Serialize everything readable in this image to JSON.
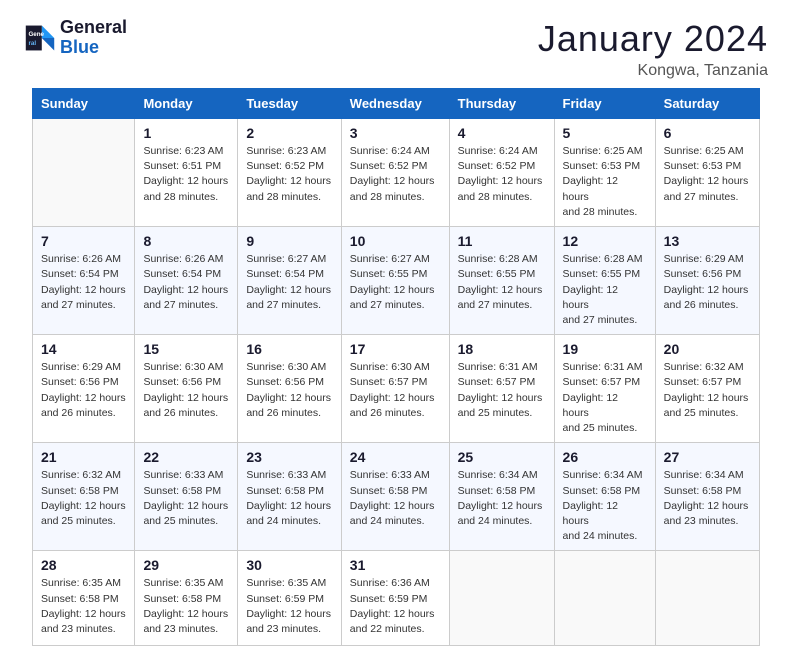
{
  "logo": {
    "general": "General",
    "blue": "Blue"
  },
  "title": "January 2024",
  "location": "Kongwa, Tanzania",
  "weekdays": [
    "Sunday",
    "Monday",
    "Tuesday",
    "Wednesday",
    "Thursday",
    "Friday",
    "Saturday"
  ],
  "weeks": [
    [
      {
        "day": "",
        "info": ""
      },
      {
        "day": "1",
        "info": "Sunrise: 6:23 AM\nSunset: 6:51 PM\nDaylight: 12 hours\nand 28 minutes."
      },
      {
        "day": "2",
        "info": "Sunrise: 6:23 AM\nSunset: 6:52 PM\nDaylight: 12 hours\nand 28 minutes."
      },
      {
        "day": "3",
        "info": "Sunrise: 6:24 AM\nSunset: 6:52 PM\nDaylight: 12 hours\nand 28 minutes."
      },
      {
        "day": "4",
        "info": "Sunrise: 6:24 AM\nSunset: 6:52 PM\nDaylight: 12 hours\nand 28 minutes."
      },
      {
        "day": "5",
        "info": "Sunrise: 6:25 AM\nSunset: 6:53 PM\nDaylight: 12 hours\nand 28 minutes."
      },
      {
        "day": "6",
        "info": "Sunrise: 6:25 AM\nSunset: 6:53 PM\nDaylight: 12 hours\nand 27 minutes."
      }
    ],
    [
      {
        "day": "7",
        "info": "Sunrise: 6:26 AM\nSunset: 6:54 PM\nDaylight: 12 hours\nand 27 minutes."
      },
      {
        "day": "8",
        "info": "Sunrise: 6:26 AM\nSunset: 6:54 PM\nDaylight: 12 hours\nand 27 minutes."
      },
      {
        "day": "9",
        "info": "Sunrise: 6:27 AM\nSunset: 6:54 PM\nDaylight: 12 hours\nand 27 minutes."
      },
      {
        "day": "10",
        "info": "Sunrise: 6:27 AM\nSunset: 6:55 PM\nDaylight: 12 hours\nand 27 minutes."
      },
      {
        "day": "11",
        "info": "Sunrise: 6:28 AM\nSunset: 6:55 PM\nDaylight: 12 hours\nand 27 minutes."
      },
      {
        "day": "12",
        "info": "Sunrise: 6:28 AM\nSunset: 6:55 PM\nDaylight: 12 hours\nand 27 minutes."
      },
      {
        "day": "13",
        "info": "Sunrise: 6:29 AM\nSunset: 6:56 PM\nDaylight: 12 hours\nand 26 minutes."
      }
    ],
    [
      {
        "day": "14",
        "info": "Sunrise: 6:29 AM\nSunset: 6:56 PM\nDaylight: 12 hours\nand 26 minutes."
      },
      {
        "day": "15",
        "info": "Sunrise: 6:30 AM\nSunset: 6:56 PM\nDaylight: 12 hours\nand 26 minutes."
      },
      {
        "day": "16",
        "info": "Sunrise: 6:30 AM\nSunset: 6:56 PM\nDaylight: 12 hours\nand 26 minutes."
      },
      {
        "day": "17",
        "info": "Sunrise: 6:30 AM\nSunset: 6:57 PM\nDaylight: 12 hours\nand 26 minutes."
      },
      {
        "day": "18",
        "info": "Sunrise: 6:31 AM\nSunset: 6:57 PM\nDaylight: 12 hours\nand 25 minutes."
      },
      {
        "day": "19",
        "info": "Sunrise: 6:31 AM\nSunset: 6:57 PM\nDaylight: 12 hours\nand 25 minutes."
      },
      {
        "day": "20",
        "info": "Sunrise: 6:32 AM\nSunset: 6:57 PM\nDaylight: 12 hours\nand 25 minutes."
      }
    ],
    [
      {
        "day": "21",
        "info": "Sunrise: 6:32 AM\nSunset: 6:58 PM\nDaylight: 12 hours\nand 25 minutes."
      },
      {
        "day": "22",
        "info": "Sunrise: 6:33 AM\nSunset: 6:58 PM\nDaylight: 12 hours\nand 25 minutes."
      },
      {
        "day": "23",
        "info": "Sunrise: 6:33 AM\nSunset: 6:58 PM\nDaylight: 12 hours\nand 24 minutes."
      },
      {
        "day": "24",
        "info": "Sunrise: 6:33 AM\nSunset: 6:58 PM\nDaylight: 12 hours\nand 24 minutes."
      },
      {
        "day": "25",
        "info": "Sunrise: 6:34 AM\nSunset: 6:58 PM\nDaylight: 12 hours\nand 24 minutes."
      },
      {
        "day": "26",
        "info": "Sunrise: 6:34 AM\nSunset: 6:58 PM\nDaylight: 12 hours\nand 24 minutes."
      },
      {
        "day": "27",
        "info": "Sunrise: 6:34 AM\nSunset: 6:58 PM\nDaylight: 12 hours\nand 23 minutes."
      }
    ],
    [
      {
        "day": "28",
        "info": "Sunrise: 6:35 AM\nSunset: 6:58 PM\nDaylight: 12 hours\nand 23 minutes."
      },
      {
        "day": "29",
        "info": "Sunrise: 6:35 AM\nSunset: 6:58 PM\nDaylight: 12 hours\nand 23 minutes."
      },
      {
        "day": "30",
        "info": "Sunrise: 6:35 AM\nSunset: 6:59 PM\nDaylight: 12 hours\nand 23 minutes."
      },
      {
        "day": "31",
        "info": "Sunrise: 6:36 AM\nSunset: 6:59 PM\nDaylight: 12 hours\nand 22 minutes."
      },
      {
        "day": "",
        "info": ""
      },
      {
        "day": "",
        "info": ""
      },
      {
        "day": "",
        "info": ""
      }
    ]
  ]
}
